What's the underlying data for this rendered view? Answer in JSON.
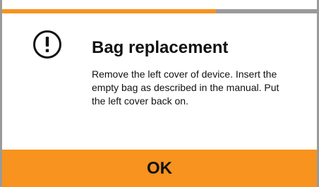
{
  "progress": {
    "fraction": 0.68
  },
  "dialog": {
    "icon": "exclamation-circle-icon",
    "title": "Bag replacement",
    "message": "Remove the left cover of device. Insert the empty bag as described in the manual. Put the left cover back on.",
    "ok_label": "OK"
  },
  "colors": {
    "accent": "#f7931e",
    "frame": "#9a9a9a",
    "text": "#111111",
    "background": "#ffffff"
  }
}
